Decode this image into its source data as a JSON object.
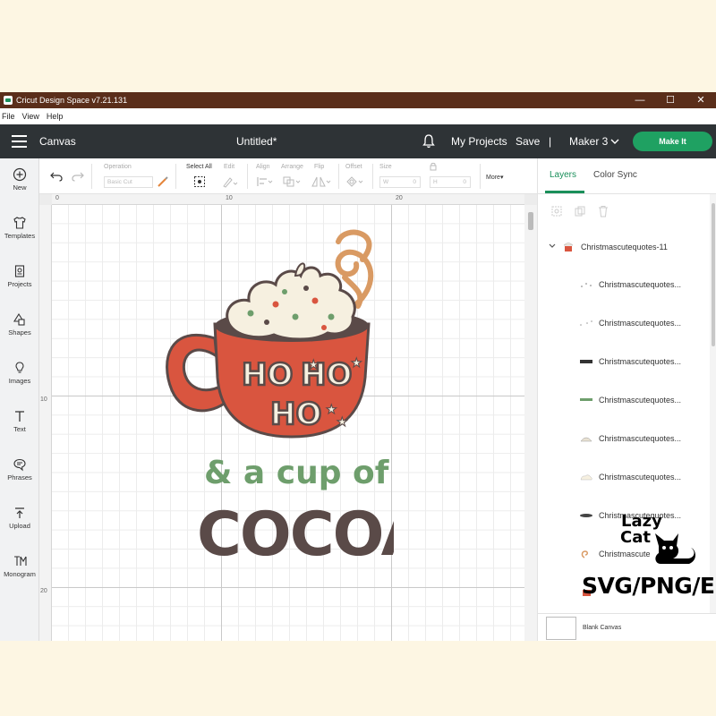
{
  "window": {
    "title": "Cricut Design Space  v7.21.131",
    "controls": [
      "—",
      "☐",
      "✕"
    ]
  },
  "menubar": [
    "File",
    "View",
    "Help"
  ],
  "header": {
    "section": "Canvas",
    "doc_title": "Untitled*",
    "my_projects": "My Projects",
    "save": "Save",
    "divider": "|",
    "machine": "Maker 3",
    "make_it": "Make It"
  },
  "sidebar": {
    "items": [
      {
        "label": "New",
        "icon": "plus-circle-icon"
      },
      {
        "label": "Templates",
        "icon": "shirt-icon"
      },
      {
        "label": "Projects",
        "icon": "projects-icon"
      },
      {
        "label": "Shapes",
        "icon": "shapes-icon"
      },
      {
        "label": "Images",
        "icon": "bulb-icon"
      },
      {
        "label": "Text",
        "icon": "text-icon"
      },
      {
        "label": "Phrases",
        "icon": "speech-icon"
      },
      {
        "label": "Upload",
        "icon": "upload-icon"
      },
      {
        "label": "Monogram",
        "icon": "monogram-icon"
      }
    ]
  },
  "toolbar": {
    "operation_label": "Operation",
    "operation_value": "Basic Cut",
    "select_all": "Select All",
    "edit": "Edit",
    "align": "Align",
    "arrange": "Arrange",
    "flip": "Flip",
    "offset": "Offset",
    "size": "Size",
    "w": "W",
    "h": "H",
    "w_value": "0",
    "h_value": "0",
    "more": "More▾"
  },
  "rulers": {
    "h_ticks": [
      "0",
      "10",
      "20"
    ],
    "v_ticks": [
      "10",
      "20"
    ]
  },
  "panel": {
    "tabs": [
      "Layers",
      "Color Sync"
    ],
    "active_tab": "Layers",
    "group_name": "Christmascutequotes-11",
    "layers": [
      "Christmascutequotes...",
      "Christmascutequotes...",
      "Christmascutequotes...",
      "Christmascutequotes...",
      "Christmascutequotes...",
      "Christmascutequotes...",
      "Christmascutequotes...",
      "Christmascute"
    ],
    "blank_canvas": "Blank Canvas"
  },
  "artwork": {
    "ho_words": [
      "HO",
      "HO",
      "HO"
    ],
    "line2": "& a cup of",
    "line3": "COCOA"
  },
  "badge": {
    "line1": "Lazy",
    "line2": "Cat",
    "formats": "SVG/PNG/EPS"
  },
  "colors": {
    "header_bg": "#2e3336",
    "accent_green": "#1fa162",
    "mug_red": "#d9553f",
    "cocoa_brown": "#5a4a48",
    "sage_green": "#6e9e6c",
    "cream": "#f6f0e0",
    "titlebar_brown": "#5a2e1a"
  }
}
